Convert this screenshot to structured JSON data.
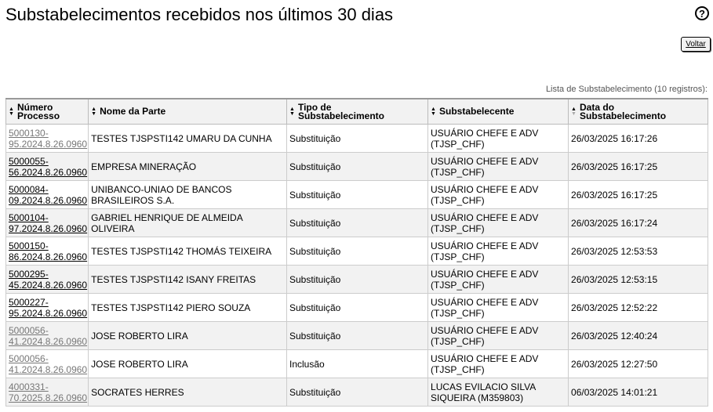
{
  "page": {
    "title": "Substabelecimentos recebidos nos últimos 30 dias",
    "help_label": "?",
    "back_button": "Voltar",
    "caption": "Lista de Substabelecimento (10 registros):"
  },
  "table": {
    "headers": [
      {
        "line1": "Número",
        "line2": "Processo"
      },
      {
        "line1": "Nome da Parte",
        "line2": ""
      },
      {
        "line1": "Tipo de",
        "line2": "Substabelecimento"
      },
      {
        "line1": "Substabelecente",
        "line2": ""
      },
      {
        "line1": "Data do",
        "line2": "Substabelecimento"
      }
    ],
    "rows": [
      {
        "proc1": "5000130-",
        "proc2": "95.2024.8.26.0960",
        "visited": true,
        "parte1": "TESTES TJSPSTI142 UMARU DA CUNHA",
        "parte2": "",
        "tipo": "Substituição",
        "sub1": "USUÁRIO CHEFE E ADV",
        "sub2": "(TJSP_CHF)",
        "data": "26/03/2025 16:17:26"
      },
      {
        "proc1": "5000055-",
        "proc2": "56.2024.8.26.0960",
        "visited": false,
        "parte1": "EMPRESA MINERAÇÃO",
        "parte2": "",
        "tipo": "Substituição",
        "sub1": "USUÁRIO CHEFE E ADV",
        "sub2": "(TJSP_CHF)",
        "data": "26/03/2025 16:17:25"
      },
      {
        "proc1": "5000084-",
        "proc2": "09.2024.8.26.0960",
        "visited": false,
        "parte1": "UNIBANCO-UNIAO DE BANCOS",
        "parte2": "BRASILEIROS S.A.",
        "tipo": "Substituição",
        "sub1": "USUÁRIO CHEFE E ADV",
        "sub2": "(TJSP_CHF)",
        "data": "26/03/2025 16:17:25"
      },
      {
        "proc1": "5000104-",
        "proc2": "97.2024.8.26.0960",
        "visited": false,
        "parte1": "GABRIEL HENRIQUE DE ALMEIDA",
        "parte2": "OLIVEIRA",
        "tipo": "Substituição",
        "sub1": "USUÁRIO CHEFE E ADV",
        "sub2": "(TJSP_CHF)",
        "data": "26/03/2025 16:17:24"
      },
      {
        "proc1": "5000150-",
        "proc2": "86.2024.8.26.0960",
        "visited": false,
        "parte1": "TESTES TJSPSTI142 THOMÁS TEIXEIRA",
        "parte2": "",
        "tipo": "Substituição",
        "sub1": "USUÁRIO CHEFE E ADV",
        "sub2": "(TJSP_CHF)",
        "data": "26/03/2025 12:53:53"
      },
      {
        "proc1": "5000295-",
        "proc2": "45.2024.8.26.0960",
        "visited": false,
        "parte1": "TESTES TJSPSTI142 ISANY FREITAS",
        "parte2": "",
        "tipo": "Substituição",
        "sub1": "USUÁRIO CHEFE E ADV",
        "sub2": "(TJSP_CHF)",
        "data": "26/03/2025 12:53:15"
      },
      {
        "proc1": "5000227-",
        "proc2": "95.2024.8.26.0960",
        "visited": false,
        "parte1": "TESTES TJSPSTI142 PIERO SOUZA",
        "parte2": "",
        "tipo": "Substituição",
        "sub1": "USUÁRIO CHEFE E ADV",
        "sub2": "(TJSP_CHF)",
        "data": "26/03/2025 12:52:22"
      },
      {
        "proc1": "5000056-",
        "proc2": "41.2024.8.26.0960",
        "visited": true,
        "parte1": "JOSE ROBERTO LIRA",
        "parte2": "",
        "tipo": "Substituição",
        "sub1": "USUÁRIO CHEFE E ADV",
        "sub2": "(TJSP_CHF)",
        "data": "26/03/2025 12:40:24"
      },
      {
        "proc1": "5000056-",
        "proc2": "41.2024.8.26.0960",
        "visited": true,
        "parte1": "JOSE ROBERTO LIRA",
        "parte2": "",
        "tipo": "Inclusão",
        "sub1": "USUÁRIO CHEFE E ADV",
        "sub2": "(TJSP_CHF)",
        "data": "26/03/2025 12:27:50"
      },
      {
        "proc1": "4000331-",
        "proc2": "70.2025.8.26.0960",
        "visited": true,
        "parte1": "SOCRATES HERRES",
        "parte2": "",
        "tipo": "Substituição",
        "sub1": "LUCAS EVILACIO SILVA",
        "sub2": "SIQUEIRA (M359803)",
        "data": "06/03/2025 14:01:21"
      }
    ]
  }
}
